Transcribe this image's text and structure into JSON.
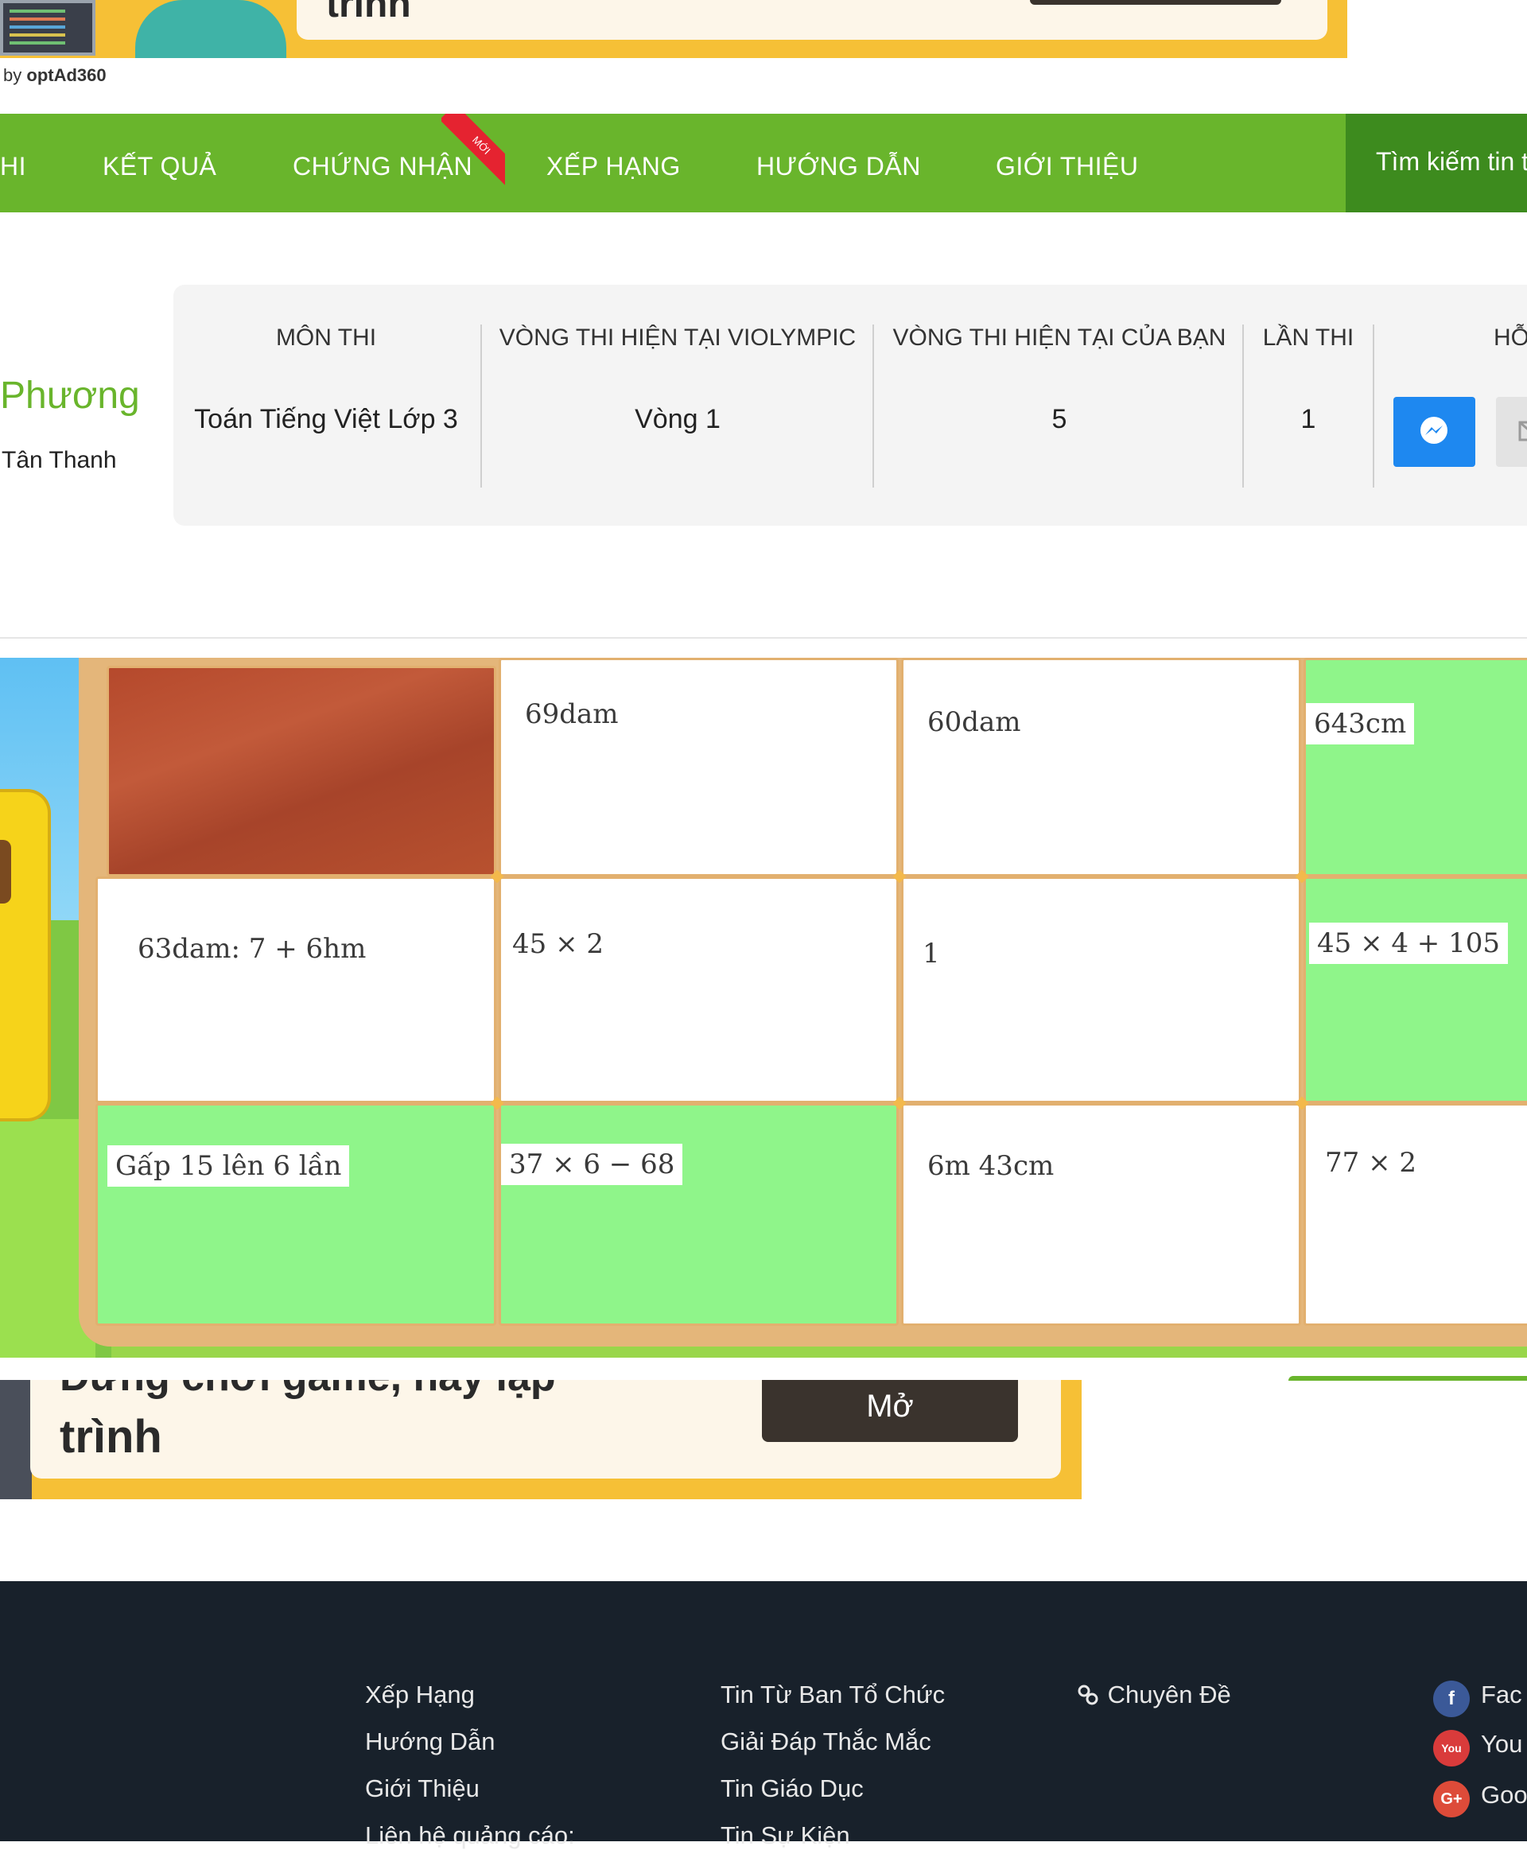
{
  "ad_top": {
    "heading": "trình",
    "by": "by",
    "brand": "optAd360"
  },
  "nav": {
    "items": [
      "HI",
      "KẾT QUẢ",
      "CHỨNG NHẬN",
      "XẾP HẠNG",
      "HƯỚNG DẪN",
      "GIỚI THIỆU"
    ],
    "new_badge": "MỚI",
    "search_label": "Tìm kiếm tin t"
  },
  "user": {
    "name": "Phương",
    "school": "Tân Thanh"
  },
  "info": {
    "headers": [
      "MÔN THI",
      "VÒNG THI HIỆN TẠI VIOLYMPIC",
      "VÒNG THI HIỆN TẠI CỦA BẠN",
      "LẦN THI",
      "HỖ"
    ],
    "values": [
      "Toán Tiếng Việt Lớp 3",
      "Vòng 1",
      "5",
      "1"
    ]
  },
  "game": {
    "cells": [
      "",
      "69dam",
      "60dam",
      "643cm",
      "63dam: 7 + 6hm",
      "45 × 2",
      "1",
      "45 × 4 + 105",
      "Gấp 15 lên 6 lần",
      "37 × 6 − 68",
      "6m 43cm",
      "77 × 2"
    ]
  },
  "ad_bottom": {
    "line1": "Đừng chơi game, hãy lập",
    "line2": "trình",
    "button": "Mở"
  },
  "footer": {
    "col1": [
      "Xếp Hạng",
      "Hướng Dẫn",
      "Giới Thiệu",
      "Liên hệ quảng cáo:"
    ],
    "col2": [
      "Tin Từ Ban Tổ Chức",
      "Giải Đáp Thắc Mắc",
      "Tin Giáo Dục",
      "Tin Sự Kiện"
    ],
    "col3": [
      "Chuyên Đề"
    ],
    "social": [
      "Fac",
      "You",
      "Goo"
    ]
  },
  "colors": {
    "brand_green": "#69b52c",
    "messenger_blue": "#1e88f0",
    "cell_green": "#8ff58a",
    "footer_bg": "#18212b"
  }
}
